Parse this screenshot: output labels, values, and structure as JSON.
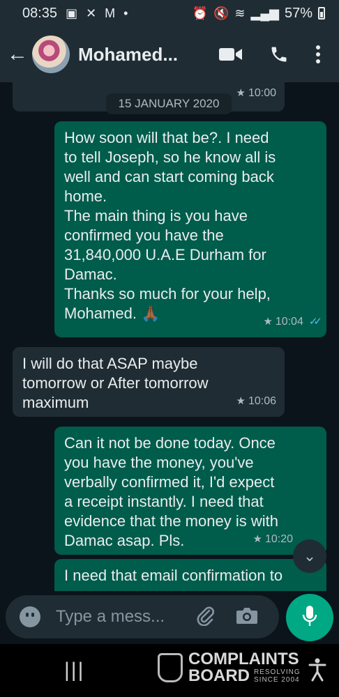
{
  "status_bar": {
    "time": "08:35",
    "battery": "57%"
  },
  "header": {
    "contact_name": "Mohamed..."
  },
  "chat": {
    "date_label": "15 JANUARY 2020",
    "top_time": "10:00",
    "messages": [
      {
        "direction": "outgoing",
        "lines": [
          "How soon will that be?. I need",
          "to tell Joseph, so he know all is",
          "well and can start coming back",
          "home.",
          "The main thing is you have",
          "confirmed you have the",
          "31,840,000 U.A.E Durham for",
          "Damac.",
          "Thanks so much for your help,",
          "Mohamed. 🙏🏾"
        ],
        "time": "10:04",
        "starred": true,
        "read": true
      },
      {
        "direction": "incoming",
        "lines": [
          "I will do that ASAP maybe",
          "tomorrow or After tomorrow",
          "maximum"
        ],
        "time": "10:06",
        "starred": true
      },
      {
        "direction": "outgoing",
        "lines": [
          "Can it not be done today. Once",
          "you have the money, you've",
          "verbally confirmed it,  I'd expect",
          "a receipt instantly. I need that",
          "evidence that the money is with",
          "Damac asap. Pls."
        ],
        "time": "10:20",
        "starred": true
      },
      {
        "direction": "outgoing",
        "lines": [
          "I need that email confirmation to"
        ]
      }
    ]
  },
  "composer": {
    "placeholder": "Type a mess..."
  },
  "watermark": {
    "line1": "COMPLAINTS",
    "line2": "BOARD",
    "tag1": "RESOLVING",
    "tag2": "SINCE 2004"
  },
  "colors": {
    "outgoing_bubble": "#005c4b",
    "incoming_bubble": "#202c33",
    "accent": "#00a884",
    "read_ticks": "#53bdeb"
  }
}
